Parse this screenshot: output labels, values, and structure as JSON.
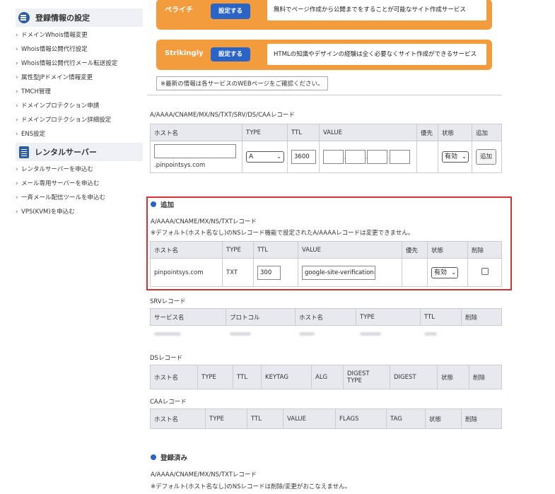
{
  "sidebar": {
    "section1": {
      "title": "登録情報の設定",
      "items": [
        "ドメインWhois情報変更",
        "Whois情報公開代行設定",
        "Whois情報公開代行メール転送設定",
        "属性型JPドメイン情報変更",
        "TMCH管理",
        "ドメインプロテクション申請",
        "ドメインプロテクション詳細設定",
        "ENS設定"
      ]
    },
    "section2": {
      "title": "レンタルサーバー",
      "items": [
        "レンタルサーバーを申込む",
        "メール専用サーバーを申込む",
        "一斉メール配信ツールを申込む",
        "VPS(KVM)を申込む"
      ]
    }
  },
  "banners": [
    {
      "name": "ペライチ",
      "button": "設定する",
      "desc": "無料でページ作成から公開までをすることが可能なサイト作成サービス"
    },
    {
      "name": "Strikingly",
      "button": "設定する",
      "desc": "HTMLの知識やデザインの経験は全く必要なくサイト作成ができるサービス"
    }
  ],
  "notice": "※最新の情報は各サービスのWEBページをご確認ください。",
  "new_record": {
    "title": "A/AAAA/CNAME/MX/NS/TXT/SRV/DS/CAAレコード",
    "headers": [
      "ホスト名",
      "TYPE",
      "TTL",
      "VALUE",
      "優先",
      "状態",
      "追加"
    ],
    "host_value": "",
    "domain_suffix": ".pinpointsys.com",
    "type_value": "A",
    "ttl_value": "3600",
    "state_value": "有効",
    "add_button": "追加"
  },
  "added": {
    "heading": "追加",
    "subtitle": "A/AAAA/CNAME/MX/NS/TXTレコード",
    "note": "※デフォルト(ホスト名なし)のNSレコード機能で設定されたA/AAAAレコードは変更できません。",
    "headers": [
      "ホスト名",
      "TYPE",
      "TTL",
      "VALUE",
      "優先",
      "状態",
      "削除"
    ],
    "row": {
      "host": "pinpointsys.com",
      "type": "TXT",
      "ttl": "300",
      "value": "google-site-verification=",
      "priority": "",
      "state": "有効"
    }
  },
  "srv": {
    "title": "SRVレコード",
    "headers": [
      "サービス名",
      "プロトコル",
      "ホスト名",
      "TYPE",
      "TTL",
      "削除"
    ]
  },
  "ds": {
    "title": "DSレコード",
    "headers": [
      "ホスト名",
      "TYPE",
      "TTL",
      "KEYTAG",
      "ALG",
      "DIGEST TYPE",
      "DIGEST",
      "状態",
      "削除"
    ]
  },
  "caa": {
    "title": "CAAレコード",
    "headers": [
      "ホスト名",
      "TYPE",
      "TTL",
      "VALUE",
      "FLAGS",
      "TAG",
      "状態",
      "削除"
    ]
  },
  "registered": {
    "heading": "登録済み",
    "subtitle": "A/AAAA/CNAME/MX/NS/TXTレコード",
    "note": "※デフォルト(ホスト名なし)のNSレコードは削除/変更がおこなえません。"
  },
  "colors": {
    "accent": "#2b64c7",
    "banner": "#f39c3d",
    "highlight": "#d93030"
  }
}
